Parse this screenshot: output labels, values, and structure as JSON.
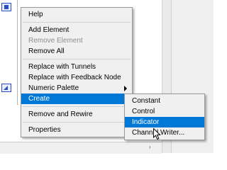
{
  "context_menu": {
    "items": [
      {
        "label": "Help",
        "enabled": true
      },
      {
        "label": "Add Element",
        "enabled": true
      },
      {
        "label": "Remove Element",
        "enabled": false
      },
      {
        "label": "Remove All",
        "enabled": true
      },
      {
        "label": "Replace with Tunnels",
        "enabled": true
      },
      {
        "label": "Replace with Feedback Node",
        "enabled": true
      },
      {
        "label": "Numeric Palette",
        "enabled": true,
        "submenu": true
      },
      {
        "label": "Create",
        "enabled": true,
        "submenu": true,
        "highlighted": true
      },
      {
        "label": "Remove and Rewire",
        "enabled": true
      },
      {
        "label": "Properties",
        "enabled": true
      }
    ]
  },
  "create_submenu": {
    "items": [
      {
        "label": "Constant"
      },
      {
        "label": "Control"
      },
      {
        "label": "Indicator",
        "highlighted": true
      },
      {
        "label": "Channel Writer..."
      }
    ]
  },
  "colors": {
    "menu_bg": "#f0f0f0",
    "highlight": "#0078d7",
    "disabled_text": "#8d8d8d"
  }
}
